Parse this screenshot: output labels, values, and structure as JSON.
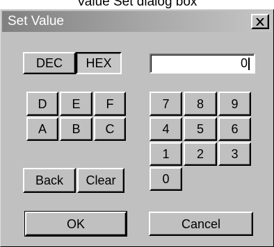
{
  "caption": "Value Set dialog box",
  "window": {
    "title": "Set Value",
    "close_label": "×"
  },
  "mode": {
    "dec_label": "DEC",
    "hex_label": "HEX",
    "selected": "HEX"
  },
  "display": {
    "value": "0"
  },
  "hex_keys": [
    "D",
    "E",
    "F",
    "A",
    "B",
    "C"
  ],
  "num_keys": [
    "7",
    "8",
    "9",
    "4",
    "5",
    "6",
    "1",
    "2",
    "3",
    "0"
  ],
  "edit": {
    "back_label": "Back",
    "clear_label": "Clear"
  },
  "actions": {
    "ok_label": "OK",
    "cancel_label": "Cancel"
  }
}
